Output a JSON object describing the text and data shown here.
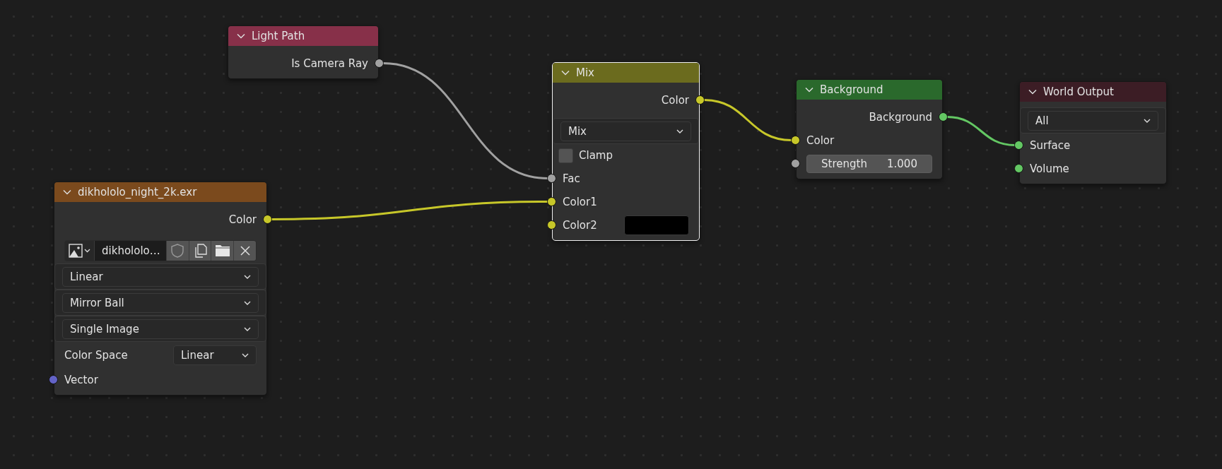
{
  "nodes": [
    {
      "title": "Light Path",
      "color": "#873049",
      "selected": false,
      "rows": [
        {
          "kind": "output",
          "label": "Is Camera Ray",
          "color": "#a1a1a1"
        }
      ]
    },
    {
      "title": "Mix",
      "color": "#6b6b1e",
      "selected": true,
      "rows": [
        {
          "kind": "output",
          "label": "Color",
          "color": "#c7c729"
        },
        {
          "kind": "dropdown",
          "value": "Mix"
        },
        {
          "kind": "checkbox",
          "label": "Clamp",
          "checked": false
        },
        {
          "kind": "input",
          "label": "Fac",
          "color": "#a1a1a1"
        },
        {
          "kind": "input",
          "label": "Color1",
          "color": "#c7c729"
        },
        {
          "kind": "color-input",
          "label": "Color2",
          "color": "#c7c729"
        }
      ]
    },
    {
      "title": "Background",
      "color": "#2a692c",
      "selected": false,
      "rows": [
        {
          "kind": "output",
          "label": "Background",
          "color": "#63c763"
        },
        {
          "kind": "input",
          "label": "Color",
          "color": "#c7c729"
        },
        {
          "kind": "value-input",
          "label": "Strength",
          "value": "1.000",
          "color": "#a1a1a1"
        }
      ]
    },
    {
      "title": "World Output",
      "color": "#3c1d25",
      "selected": false,
      "rows": [
        {
          "kind": "dropdown",
          "value": "All"
        },
        {
          "kind": "input",
          "label": "Surface",
          "color": "#63c763"
        },
        {
          "kind": "input",
          "label": "Volume",
          "color": "#63c763"
        }
      ]
    },
    {
      "title": "dikhololo_night_2k.exr",
      "color": "#7b4a1d",
      "selected": false,
      "rows": [
        {
          "kind": "output",
          "label": "Color",
          "color": "#c7c729"
        },
        {
          "kind": "image-selector",
          "value": "dikhololo…"
        },
        {
          "kind": "dropdown",
          "value": "Linear"
        },
        {
          "kind": "dropdown",
          "value": "Mirror Ball"
        },
        {
          "kind": "dropdown",
          "value": "Single Image"
        },
        {
          "kind": "labeled-dropdown",
          "label": "Color Space",
          "value": "Linear"
        },
        {
          "kind": "input",
          "label": "Vector",
          "color": "#6363c7"
        }
      ]
    }
  ]
}
